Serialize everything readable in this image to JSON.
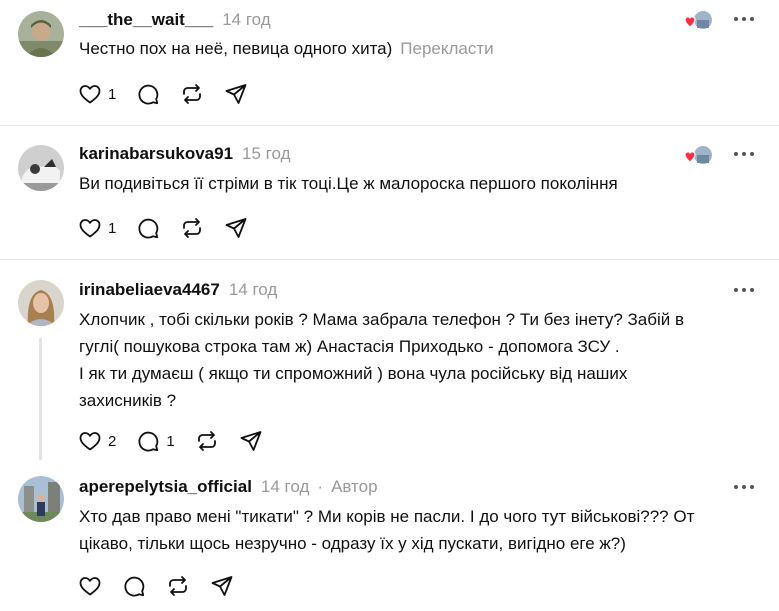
{
  "comments": [
    {
      "username": "___the__wait___",
      "time": "14 год",
      "text": "Честно пох на неё, певица одного хита)",
      "translate_label": "Перекласти",
      "author_label": "",
      "like_count": "1",
      "reply_count": "",
      "liked_by_author": true,
      "icons": [
        "like-icon",
        "reply-icon",
        "repost-icon",
        "share-icon"
      ]
    },
    {
      "username": "karinabarsukova91",
      "time": "15 год",
      "text": "Ви подивіться її стріми в тік тоці.Це ж малороска першого покоління",
      "translate_label": "",
      "author_label": "",
      "like_count": "1",
      "reply_count": "",
      "liked_by_author": true,
      "icons": [
        "like-icon",
        "reply-icon",
        "repost-icon",
        "share-icon"
      ]
    },
    {
      "username": "irinabeliaeva4467",
      "time": "14 год",
      "text_lines": [
        "Хлопчик , тобі скільки років ? Мама забрала телефон ? Ти без інету? Забій в",
        "гуглі( пошукова строка там ж) Анастасія Приходько - допомога ЗСУ .",
        "І як ти думаєш ( якщо ти спроможний ) вона чула російську від наших",
        "захисників ?"
      ],
      "translate_label": "",
      "author_label": "",
      "like_count": "2",
      "reply_count": "1",
      "liked_by_author": false,
      "icons": [
        "like-icon",
        "reply-icon",
        "repost-icon",
        "share-icon"
      ]
    },
    {
      "username": "aperepelytsia_official",
      "time": "14 год",
      "separator": "·",
      "author_label": "Автор",
      "text_lines": [
        "Хто дав право мені \"тикати\" ? Ми корів не пасли. І до чого тут військові??? От",
        "цікаво, тільки щось незручно - одразу їх у хід пускати, вигідно еге ж?)"
      ],
      "translate_label": "",
      "like_count": "",
      "reply_count": "",
      "liked_by_author": false,
      "icons": [
        "like-icon",
        "reply-icon",
        "repost-icon",
        "share-icon"
      ]
    }
  ],
  "colors": {
    "text": "#101010",
    "muted": "#999999",
    "divider": "#e5e5e5",
    "heart": "#ff3040"
  }
}
